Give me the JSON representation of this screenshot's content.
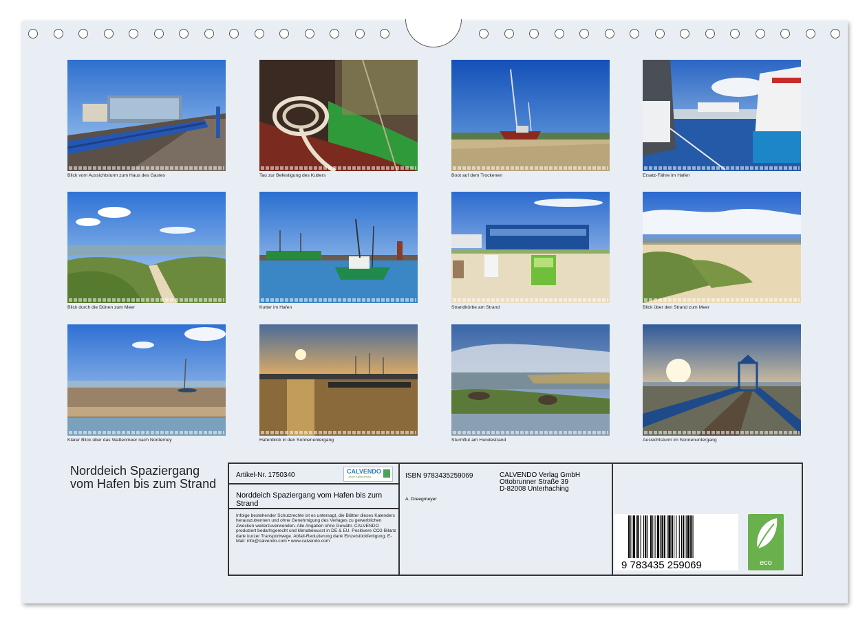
{
  "photos": [
    {
      "caption": "Blick vom Aussichtsturm zum Haus des Gastes"
    },
    {
      "caption": "Tau zur Befestigung des Kutters"
    },
    {
      "caption": "Boot auf dem Trockenen"
    },
    {
      "caption": "Ersatz-Fähre im Hafen"
    },
    {
      "caption": "Blick durch die Dünen zum Meer"
    },
    {
      "caption": "Kutter im Hafen"
    },
    {
      "caption": "Strandkörbe am Strand"
    },
    {
      "caption": "Blick über den Strand zum Meer"
    },
    {
      "caption": "Klarer Blick über das Wattenmeer nach Norderney"
    },
    {
      "caption": "Hafenblick in den Sonnenuntergang"
    },
    {
      "caption": "Sturmflut am Hundestrand"
    },
    {
      "caption": "Aussichtsturm im Sonnenuntergang"
    }
  ],
  "title": "Norddeich Spaziergang vom Hafen bis zum Strand",
  "info": {
    "article": "Artikel-Nr. 1750340",
    "brand": "CALVENDO",
    "brand_sub": "Jeder Kalendertag",
    "subtitle": "Norddeich Spaziergang vom Hafen bis zum Strand",
    "legal": "Infolge bestehender Schutzrechte ist es untersagt, die Blätter dieses Kalenders herauszutrennen und ohne Genehmigung des Verlages zu gewerblichen Zwecken weiterzuverwenden. Alle Angaben ohne Gewähr. CALVENDO produziert bedarfsgerecht und klimabewusst in DE & EU. Positivere CO2-Bilanz dank kurzer Transportwege. Abfall-Reduzierung dank Einzelstückfertigung. E-Mail: info@calvendo.com • www.calvendo.com",
    "isbn": "ISBN 9783435259069",
    "publisher_line1": "CALVENDO Verlag GmbH",
    "publisher_line2": "Ottobrunner Straße 39",
    "publisher_line3": "D-82008 Unterhaching",
    "author": "A. Dreegmeyer",
    "barcode_digits": "9  783435  259069",
    "eco_label": "eco"
  }
}
